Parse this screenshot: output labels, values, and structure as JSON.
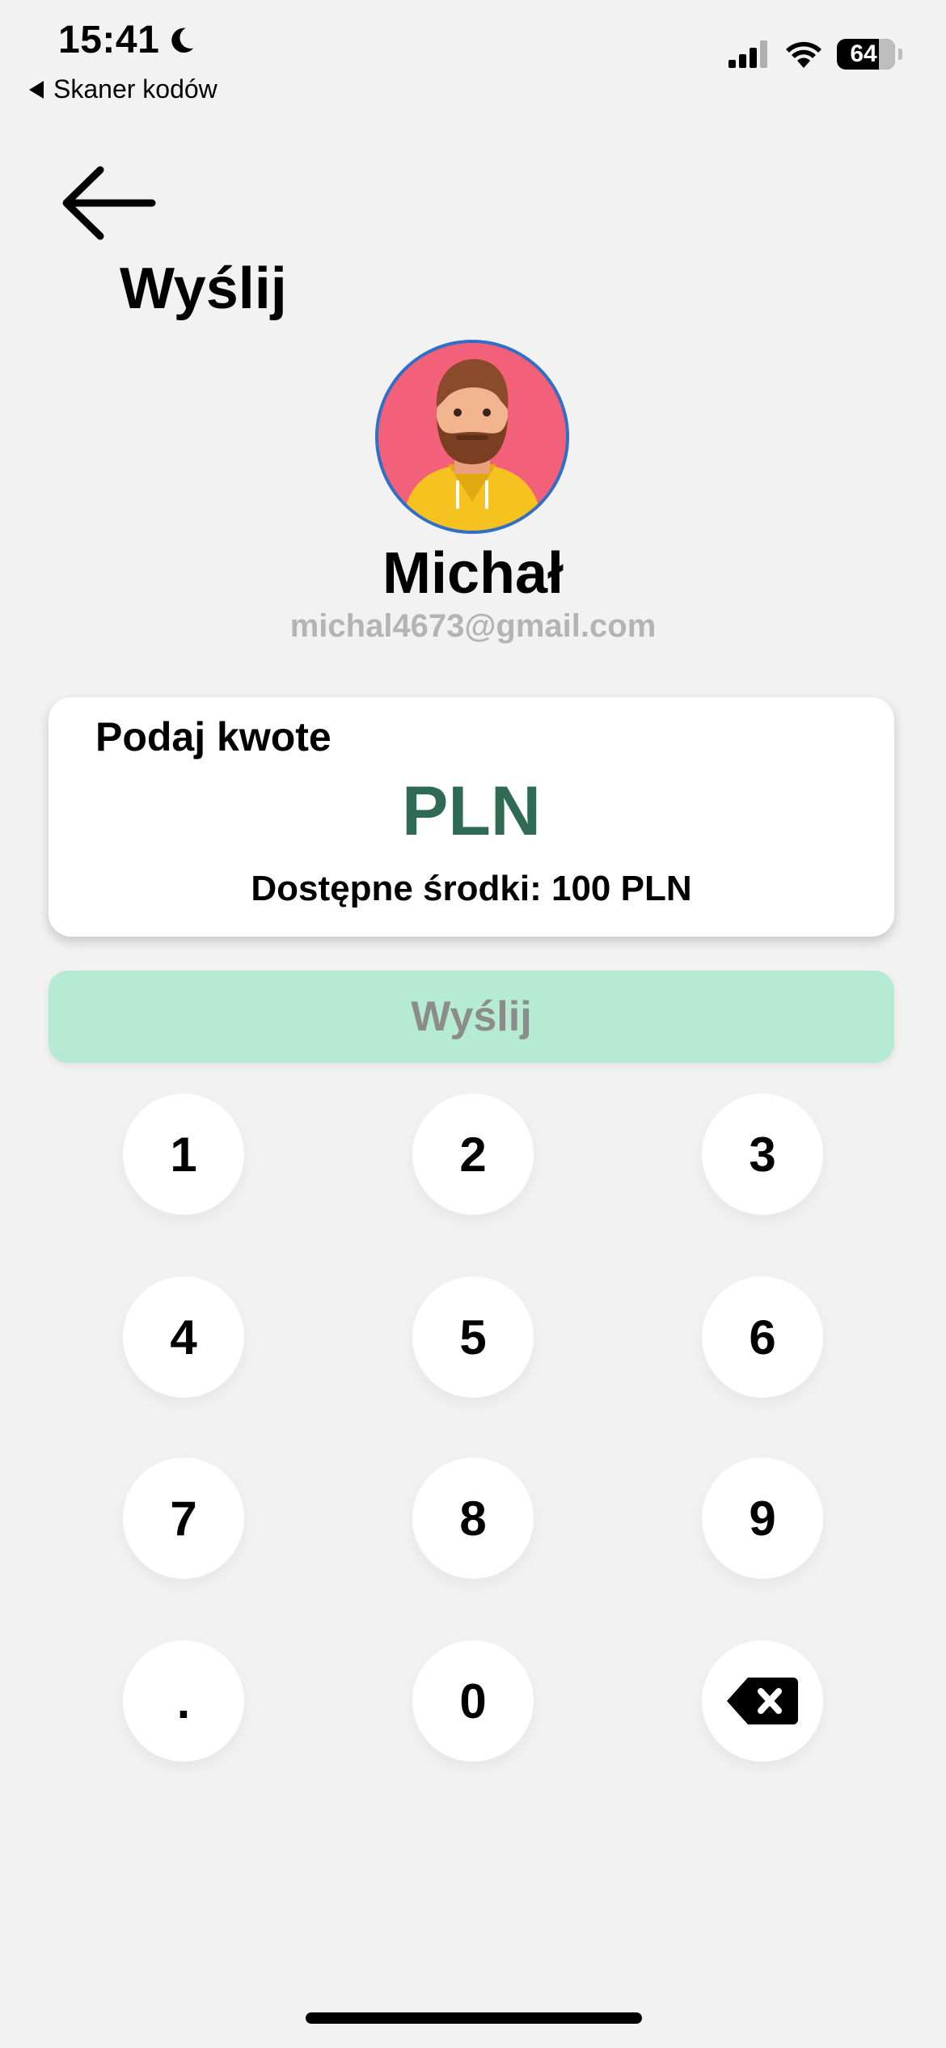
{
  "status_bar": {
    "time": "15:41",
    "back_app_label": "Skaner kodów",
    "battery_level": "64"
  },
  "header": {
    "title": "Wyślij"
  },
  "recipient": {
    "name": "Michał",
    "email": "michal4673@gmail.com"
  },
  "amount_card": {
    "label": "Podaj kwote",
    "currency": "PLN",
    "available": "Dostępne środki: 100 PLN"
  },
  "send_button": {
    "label": "Wyślij",
    "color": "#b5ebd3"
  },
  "keypad": {
    "keys": [
      "1",
      "2",
      "3",
      "4",
      "5",
      "6",
      "7",
      "8",
      "9",
      ".",
      "0"
    ],
    "backspace_icon": "backspace-icon"
  },
  "colors": {
    "background": "#f2f2f2",
    "currency": "#2f6b54",
    "email": "#b4b4b4"
  }
}
